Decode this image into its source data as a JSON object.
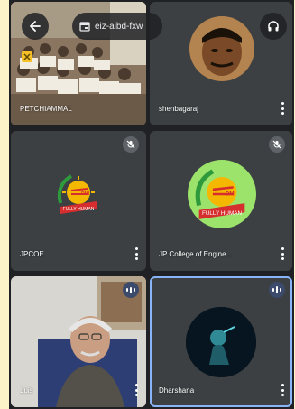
{
  "meeting": {
    "code": "eiz-aibd-fxw"
  },
  "icons": {
    "back": "arrow-back-icon",
    "calendar": "calendar-icon",
    "audio": "headphones-icon",
    "mic_off": "mic-off-icon",
    "more": "more-vert-icon",
    "speaking": "audio-level-icon"
  },
  "colors": {
    "page_border": "#fcf3c8",
    "background": "#202124",
    "tile": "#3c4043",
    "active_speaker_outline": "#8ab4f8",
    "logo_green": "#2e9a3c",
    "logo_red": "#d62e2e",
    "logo_yellow": "#f5b800"
  },
  "participants": [
    {
      "name": "PETCHIAMMAL",
      "media": "video",
      "muted": false
    },
    {
      "name": "shenbagaraj",
      "media": "avatar",
      "muted": false
    },
    {
      "name": "JPCOE",
      "media": "logo",
      "muted": true,
      "logo_text": "FULLY HUMAN",
      "logo_badge": "DMI"
    },
    {
      "name": "JP College of Engine...",
      "media": "logo",
      "muted": true,
      "logo_text": "FULLY HUMAN",
      "logo_badge": "DMI"
    },
    {
      "name": "Luis",
      "media": "video",
      "speaking": true
    },
    {
      "name": "Dharshana",
      "media": "avatar",
      "speaking": true,
      "active": true
    }
  ]
}
